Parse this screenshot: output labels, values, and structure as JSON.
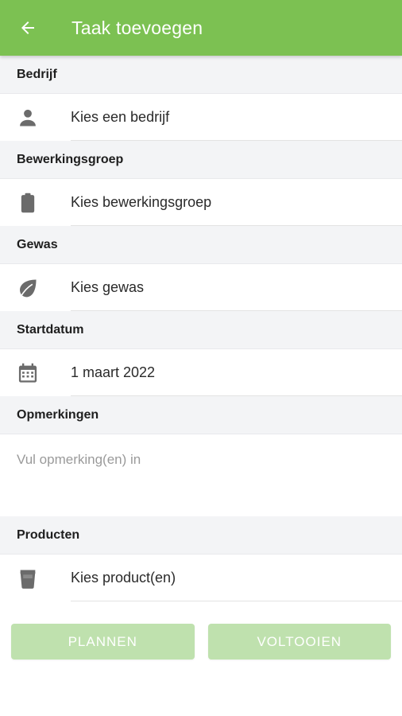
{
  "header": {
    "title": "Taak toevoegen",
    "back_icon": "arrow-left-icon"
  },
  "colors": {
    "accent": "#7cc152",
    "button_disabled": "#bfe1ae",
    "icon": "#6b6b6b"
  },
  "sections": {
    "bedrijf": {
      "label": "Bedrijf",
      "value": "Kies een bedrijf",
      "icon": "person-icon"
    },
    "bewerkingsgroep": {
      "label": "Bewerkingsgroep",
      "value": "Kies bewerkingsgroep",
      "icon": "clipboard-icon"
    },
    "gewas": {
      "label": "Gewas",
      "value": "Kies gewas",
      "icon": "leaf-icon"
    },
    "startdatum": {
      "label": "Startdatum",
      "value": "1 maart 2022",
      "icon": "calendar-icon"
    },
    "opmerkingen": {
      "label": "Opmerkingen",
      "placeholder": "Vul opmerking(en) in"
    },
    "producten": {
      "label": "Producten",
      "value": "Kies product(en)",
      "icon": "container-icon"
    }
  },
  "actions": {
    "plan_label": "PLANNEN",
    "complete_label": "VOLTOOIEN"
  }
}
